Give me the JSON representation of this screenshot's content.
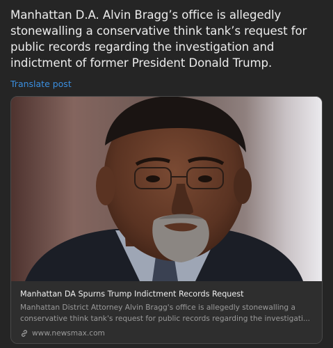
{
  "post": {
    "text": "Manhattan D.A. Alvin Bragg’s office is allegedly stonewalling a conservative think tank’s request for public records regarding the investigation and indictment of former President Donald Trump.",
    "translate_label": "Translate post"
  },
  "link_card": {
    "title": "Manhattan DA Spurns Trump Indictment Records Request",
    "description_line1": "Manhattan District Attorney Alvin Bragg's office is allegedly stonewalling a",
    "description_line2": "conservative think tank's request for public records regarding the investigati...",
    "source": "www.newsmax.com",
    "source_icon": "link-icon",
    "image_subject": "portrait of a man in a suit with glasses"
  },
  "colors": {
    "background": "#252525",
    "link": "#3b8fe0",
    "card_border": "#4a4a4a"
  }
}
